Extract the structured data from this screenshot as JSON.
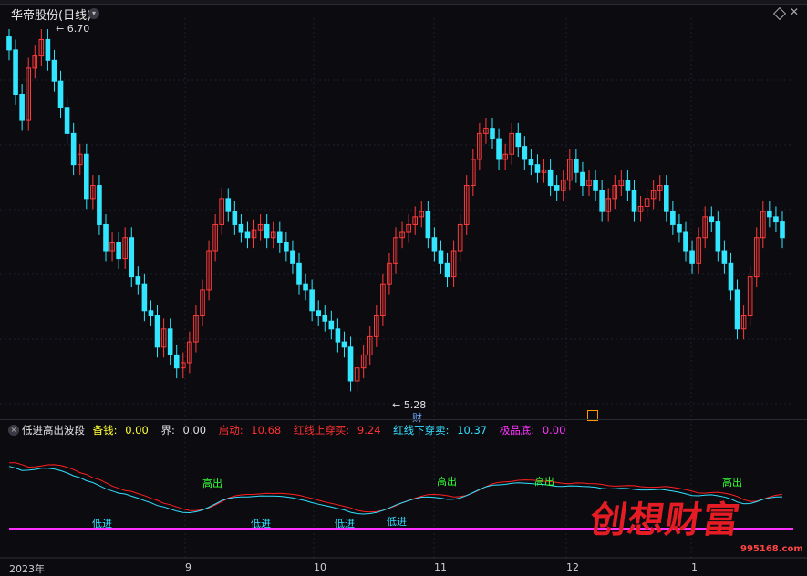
{
  "header": {
    "title": "华帝股份(日线)"
  },
  "price": {
    "high_label": "6.70",
    "low_label": "5.28"
  },
  "badges": {
    "cai": "财"
  },
  "indicator": {
    "name": "低进高出波段",
    "fields": [
      {
        "label": "备钱:",
        "value": "0.00",
        "color": "yellow"
      },
      {
        "label": "界:",
        "value": "0.00",
        "color": "white"
      },
      {
        "label": "启动:",
        "value": "10.68",
        "color": "red"
      },
      {
        "label": "红线上穿买:",
        "value": "9.24",
        "color": "red"
      },
      {
        "label": "红线下穿卖:",
        "value": "10.37",
        "color": "cyan"
      },
      {
        "label": "极品底:",
        "value": "0.00",
        "color": "magenta"
      }
    ],
    "signals": {
      "high_out": "高出",
      "low_in": "低进"
    }
  },
  "xaxis": {
    "labels": [
      "2023年",
      "9",
      "10",
      "11",
      "12",
      "1"
    ]
  },
  "watermark": {
    "text": "创想财富",
    "url": "995168.com"
  },
  "colors": {
    "up": "#ff3b3b",
    "down": "#33e6ff",
    "magenta": "#ff33ff",
    "yellow": "#ffff33",
    "green": "#33ff33"
  },
  "chart_data": {
    "type": "candlestick",
    "x_start_label": "2023年",
    "y_marks": {
      "max": 6.7,
      "min": 5.28
    },
    "close": [
      6.62,
      6.45,
      6.35,
      6.55,
      6.6,
      6.66,
      6.58,
      6.5,
      6.4,
      6.3,
      6.18,
      6.22,
      6.05,
      6.1,
      5.95,
      5.85,
      5.88,
      5.82,
      5.9,
      5.75,
      5.72,
      5.62,
      5.6,
      5.48,
      5.55,
      5.45,
      5.4,
      5.42,
      5.5,
      5.6,
      5.7,
      5.85,
      5.95,
      6.05,
      6.0,
      5.95,
      5.92,
      5.9,
      5.93,
      5.95,
      5.9,
      5.92,
      5.88,
      5.85,
      5.8,
      5.72,
      5.7,
      5.62,
      5.6,
      5.58,
      5.55,
      5.5,
      5.48,
      5.35,
      5.4,
      5.45,
      5.52,
      5.6,
      5.72,
      5.8,
      5.9,
      5.92,
      5.95,
      5.98,
      6.0,
      5.9,
      5.85,
      5.8,
      5.75,
      5.85,
      5.95,
      6.1,
      6.2,
      6.3,
      6.32,
      6.28,
      6.2,
      6.22,
      6.3,
      6.25,
      6.2,
      6.18,
      6.15,
      6.16,
      6.1,
      6.08,
      6.12,
      6.2,
      6.15,
      6.1,
      6.12,
      6.08,
      6.0,
      6.05,
      6.1,
      6.12,
      6.08,
      6.0,
      6.02,
      6.05,
      6.08,
      6.1,
      6.0,
      5.95,
      5.92,
      5.85,
      5.8,
      5.9,
      5.98,
      5.96,
      5.85,
      5.8,
      5.7,
      5.55,
      5.6,
      5.75,
      5.9,
      6.0,
      5.98,
      5.96,
      5.9
    ]
  }
}
